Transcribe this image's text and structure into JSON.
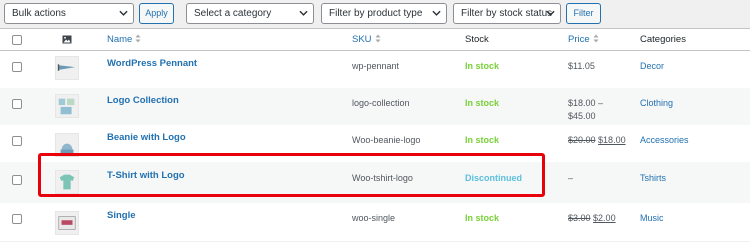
{
  "toolbar": {
    "bulk_actions": "Bulk actions",
    "apply": "Apply",
    "category": "Select a category",
    "product_type": "Filter by product type",
    "stock_status": "Filter by stock status",
    "filter": "Filter"
  },
  "columns": {
    "name": "Name",
    "sku": "SKU",
    "stock": "Stock",
    "price": "Price",
    "categories": "Categories"
  },
  "rows": [
    {
      "name": "WordPress Pennant",
      "sku": "wp-pennant",
      "stock": "In stock",
      "price_line1": "$11.05",
      "price_line2": "",
      "category": "Decor"
    },
    {
      "name": "Logo Collection",
      "sku": "logo-collection",
      "stock": "In stock",
      "price_line1": "$18.00 –",
      "price_line2": "$45.00",
      "category": "Clothing"
    },
    {
      "name": "Beanie with Logo",
      "sku": "Woo-beanie-logo",
      "stock": "In stock",
      "price_old": "$20.00",
      "price_new": "$18.00",
      "category": "Accessories"
    },
    {
      "name": "T-Shirt with Logo",
      "sku": "Woo-tshirt-logo",
      "stock": "Discontinued",
      "price_line1": "–",
      "category": "Tshirts"
    },
    {
      "name": "Single",
      "sku": "woo-single",
      "stock": "In stock",
      "price_old": "$3.00",
      "price_new": "$2.00",
      "category": "Music"
    }
  ],
  "icons": {
    "chevron": "chevron-down-icon",
    "image_column": "image-icon",
    "sort": "sort-icon"
  },
  "colors": {
    "link": "#2271b1",
    "in_stock": "#7ad03a",
    "discontinued": "#5bc0de",
    "highlight": "#e8000b"
  }
}
